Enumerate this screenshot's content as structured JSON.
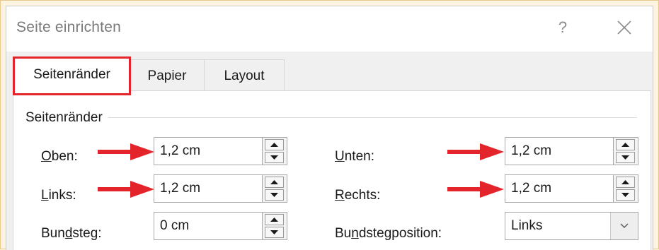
{
  "dialog": {
    "title": "Seite einrichten",
    "help": "?"
  },
  "tabs": [
    {
      "label": "Seitenränder",
      "active": true
    },
    {
      "label": "Papier",
      "active": false
    },
    {
      "label": "Layout",
      "active": false
    }
  ],
  "margins": {
    "group_label": "Seitenränder",
    "oben": {
      "mnemonic": "O",
      "rest": "ben:",
      "value": "1,2 cm"
    },
    "unten": {
      "mnemonic": "U",
      "rest": "nten:",
      "value": "1,2 cm"
    },
    "links": {
      "mnemonic": "L",
      "rest": "inks:",
      "value": "1,2 cm"
    },
    "rechts": {
      "mnemonic": "R",
      "rest": "echts:",
      "value": "1,2 cm"
    },
    "bundsteg": {
      "pre": "Bun",
      "mnemonic": "d",
      "rest": "steg:",
      "value": "0 cm"
    },
    "bundstegposition": {
      "pre": "Bu",
      "mnemonic": "n",
      "rest": "dstegposition:",
      "value": "Links"
    }
  },
  "colors": {
    "highlight": "#e3242b",
    "arrow": "#e3242b",
    "frame_bg": "#fdf3e1"
  },
  "icons": [
    "help-icon",
    "close-icon",
    "spin-up-icon",
    "spin-down-icon",
    "chevron-down-icon",
    "red-arrow-icon"
  ]
}
